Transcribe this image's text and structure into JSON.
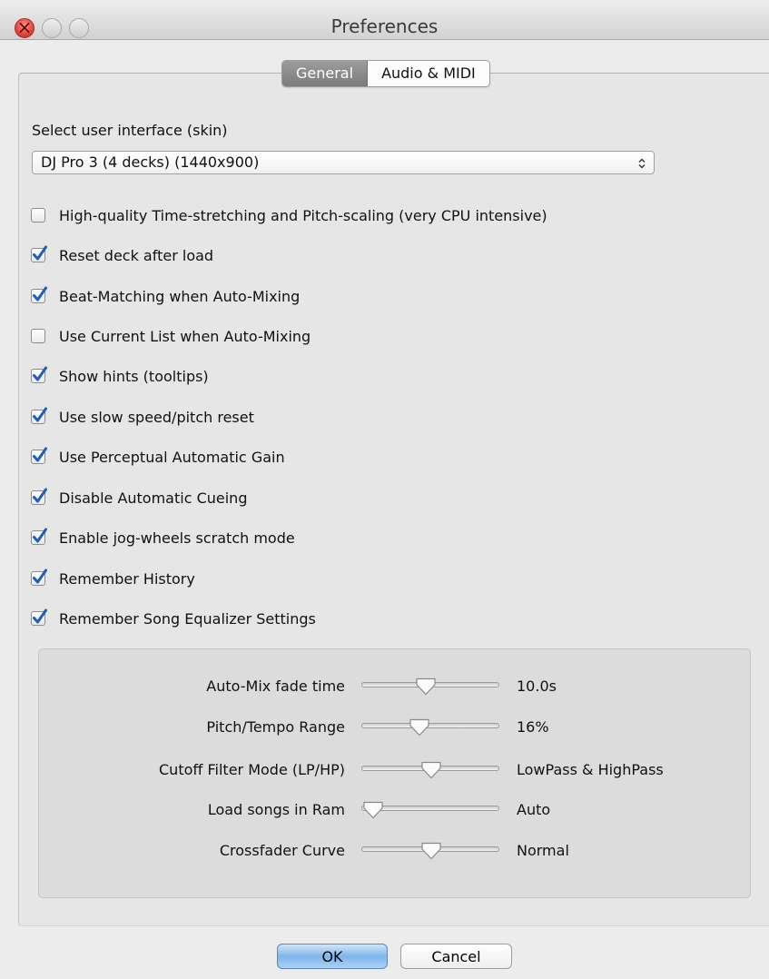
{
  "window": {
    "title": "Preferences"
  },
  "tabs": [
    {
      "label": "General",
      "active": true
    },
    {
      "label": "Audio & MIDI",
      "active": false
    }
  ],
  "skin": {
    "label": "Select user interface (skin)",
    "value": "DJ Pro 3 (4 decks) (1440x900)",
    "arrows": "⌃⌄"
  },
  "options": [
    {
      "label": "High-quality Time-stretching and Pitch-scaling (very CPU intensive)",
      "checked": false
    },
    {
      "label": "Reset deck after load",
      "checked": true
    },
    {
      "label": "Beat-Matching when Auto-Mixing",
      "checked": true
    },
    {
      "label": "Use Current List when Auto-Mixing",
      "checked": false
    },
    {
      "label": "Show hints (tooltips)",
      "checked": true
    },
    {
      "label": "Use slow speed/pitch reset",
      "checked": true
    },
    {
      "label": "Use Perceptual Automatic Gain",
      "checked": true
    },
    {
      "label": "Disable Automatic Cueing",
      "checked": true
    },
    {
      "label": "Enable jog-wheels scratch mode",
      "checked": true
    },
    {
      "label": "Remember History",
      "checked": true
    },
    {
      "label": "Remember Song Equalizer Settings",
      "checked": true
    }
  ],
  "sliders": [
    {
      "label": "Auto-Mix fade time",
      "value": "10.0s",
      "position": 0.45
    },
    {
      "label": "Pitch/Tempo Range",
      "value": "16%",
      "position": 0.4
    },
    {
      "label": "Cutoff Filter Mode (LP/HP)",
      "value": "LowPass & HighPass",
      "position": 0.5
    },
    {
      "label": "Load songs in Ram",
      "value": "Auto",
      "position": 0.0
    },
    {
      "label": "Crossfader Curve",
      "value": "Normal",
      "position": 0.5
    }
  ],
  "buttons": {
    "ok": "OK",
    "cancel": "Cancel"
  },
  "colors": {
    "accent_blue": "#7fb6ea",
    "check_blue": "#1f5fb5",
    "close_red": "#e0443a"
  }
}
